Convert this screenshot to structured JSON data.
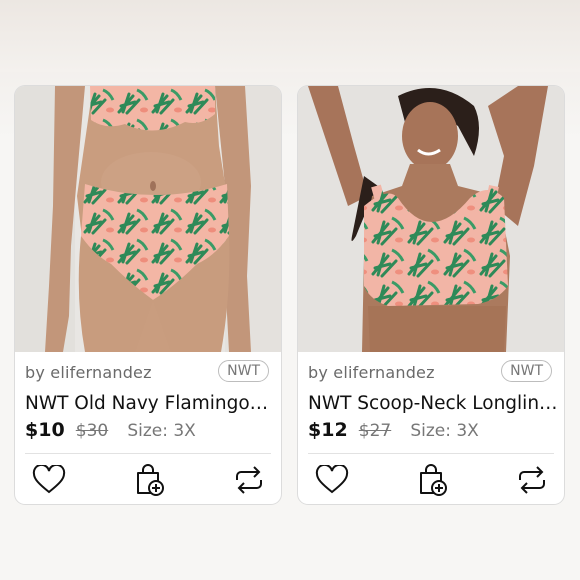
{
  "listings": [
    {
      "seller": "by elifernandez",
      "badge": "NWT",
      "title": "NWT Old Navy Flamingo…",
      "price": "$10",
      "original_price": "$30",
      "size": "Size: 3X"
    },
    {
      "seller": "by elifernandez",
      "badge": "NWT",
      "title": "NWT Scoop-Neck Longlin…",
      "price": "$12",
      "original_price": "$27",
      "size": "Size: 3X"
    }
  ],
  "icons": {
    "like": "heart-icon",
    "bundle": "shopping-bag-plus-icon",
    "share": "share-arrows-icon"
  },
  "colors": {
    "print_pink": "#f2b3a3",
    "print_green": "#2f8a5a",
    "skin": "#c69b7e",
    "text": "#111111",
    "muted": "#777777"
  }
}
